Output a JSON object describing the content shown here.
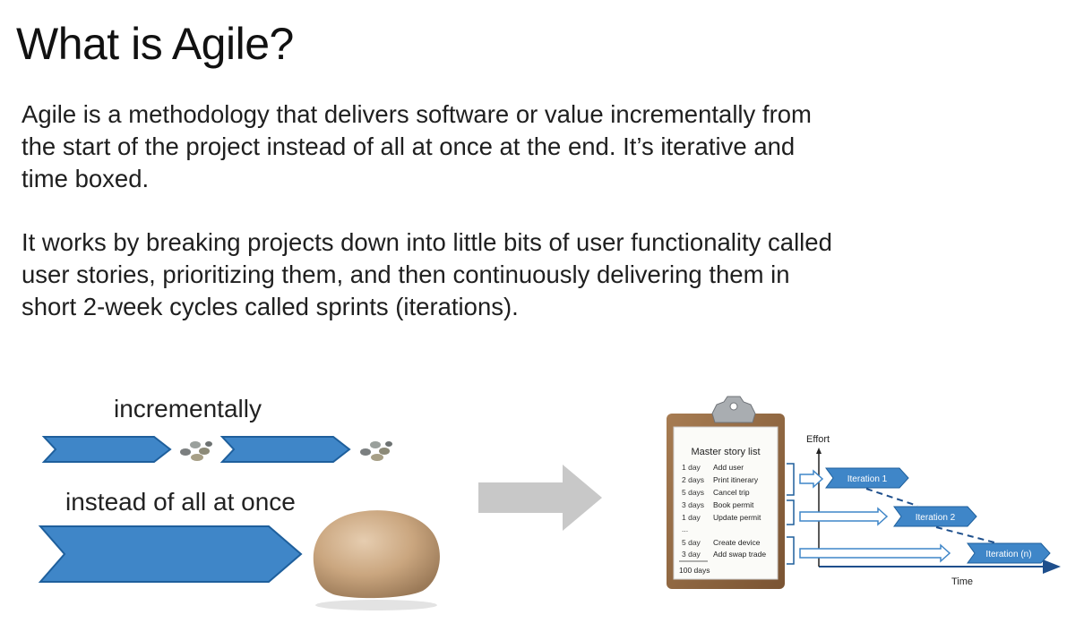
{
  "slide": {
    "title": "What is Agile?",
    "paragraph1_lines": [
      "Agile is a methodology that delivers software or value incrementally from",
      "the start of the project instead of all at once at the end. It’s iterative and",
      "time boxed."
    ],
    "paragraph2_lines": [
      "It works by breaking projects down into little bits of user functionality called",
      "user stories, prioritizing them, and then continuously delivering them in",
      "short 2-week cycles called sprints (iterations)."
    ]
  },
  "illustration": {
    "incremental_label": "incrementally",
    "all_at_once_label": "instead of all at once"
  },
  "story_diagram": {
    "list_title": "Master story list",
    "stories": [
      {
        "duration": "1 day",
        "name": "Add user"
      },
      {
        "duration": "2 days",
        "name": "Print itinerary"
      },
      {
        "duration": "5 days",
        "name": "Cancel trip"
      },
      {
        "duration": "3 days",
        "name": "Book permit"
      },
      {
        "duration": "1 day",
        "name": "Update permit"
      },
      {
        "duration": "...",
        "name": ""
      },
      {
        "duration": "5 day",
        "name": "Create device"
      },
      {
        "duration": "3 day",
        "name": "Add swap trade"
      }
    ],
    "total": "100 days",
    "y_axis_label": "Effort",
    "x_axis_label": "Time",
    "iterations": [
      "Iteration 1",
      "Iteration 2",
      "Iteration (n)"
    ]
  },
  "colors": {
    "arrow_fill": "#3f86c8",
    "arrow_stroke": "#1e5f9c",
    "grey_arrow": "#c8c8c8"
  }
}
